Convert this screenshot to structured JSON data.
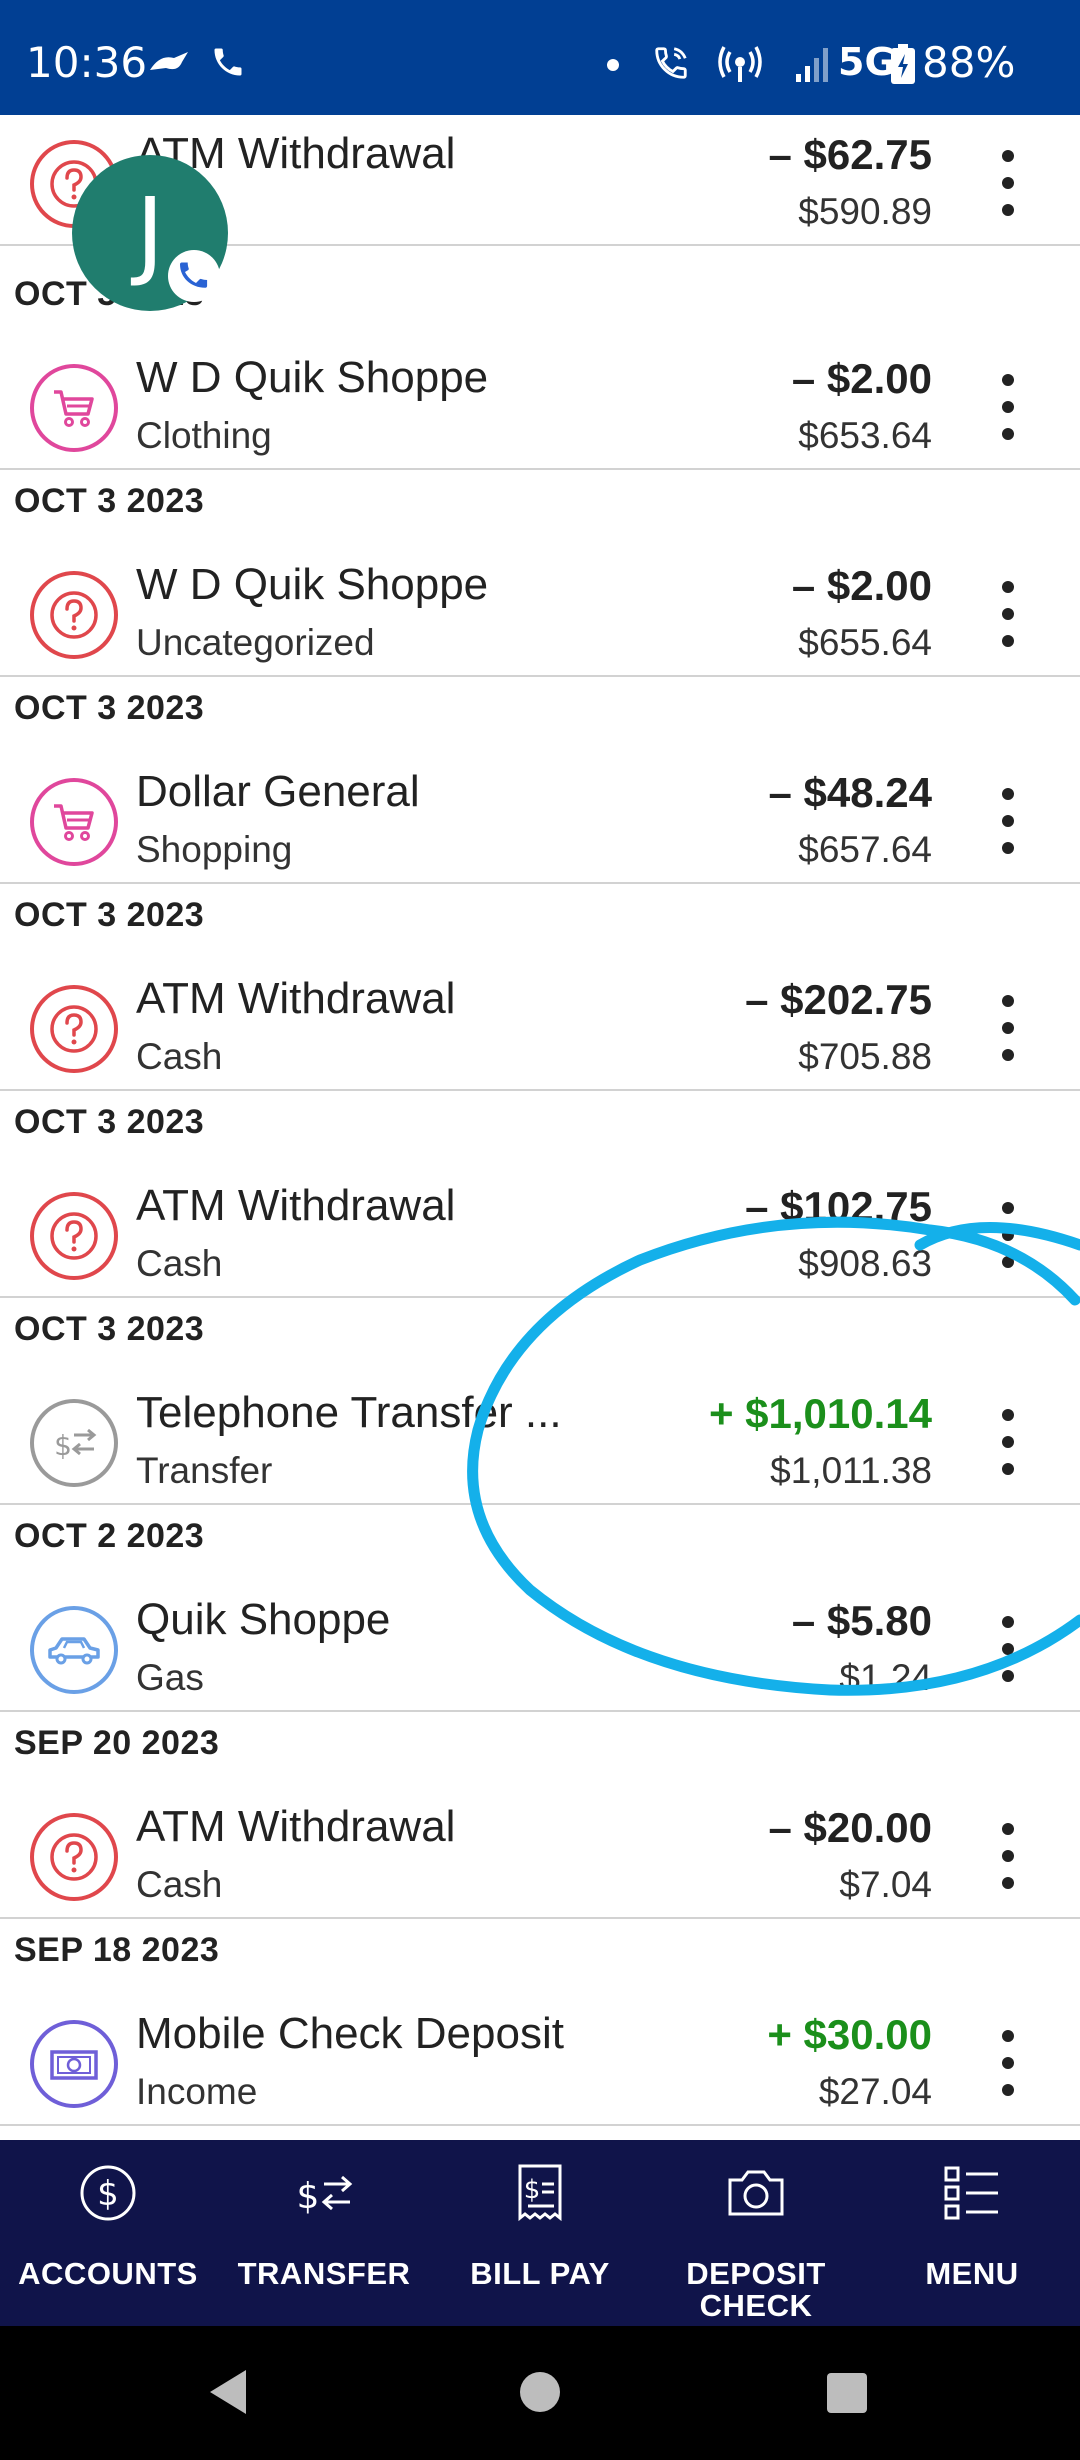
{
  "status_bar": {
    "time": "10:36",
    "network": "5G",
    "battery": "88%"
  },
  "avatar": {
    "initial": "J"
  },
  "transactions": [
    {
      "date": "",
      "name": "ATM Withdrawal",
      "category": "",
      "amount": "– $62.75",
      "balance": "$590.89",
      "type": "debit",
      "icon": "question-icon",
      "icon_color": "#e0474c"
    },
    {
      "date": "OCT 3 2023",
      "name": "W D Quik Shoppe",
      "category": "Clothing",
      "amount": "– $2.00",
      "balance": "$653.64",
      "type": "debit",
      "icon": "cart-icon",
      "icon_color": "#e0479c"
    },
    {
      "date": "OCT 3 2023",
      "name": "W D Quik Shoppe",
      "category": "Uncategorized",
      "amount": "– $2.00",
      "balance": "$655.64",
      "type": "debit",
      "icon": "question-icon",
      "icon_color": "#e0474c"
    },
    {
      "date": "OCT 3 2023",
      "name": "Dollar General",
      "category": "Shopping",
      "amount": "– $48.24",
      "balance": "$657.64",
      "type": "debit",
      "icon": "cart-icon",
      "icon_color": "#e0479c"
    },
    {
      "date": "OCT 3 2023",
      "name": "ATM Withdrawal",
      "category": "Cash",
      "amount": "– $202.75",
      "balance": "$705.88",
      "type": "debit",
      "icon": "question-icon",
      "icon_color": "#e0474c"
    },
    {
      "date": "OCT 3 2023",
      "name": "ATM Withdrawal",
      "category": "Cash",
      "amount": "– $102.75",
      "balance": "$908.63",
      "type": "debit",
      "icon": "question-icon",
      "icon_color": "#e0474c"
    },
    {
      "date": "OCT 3 2023",
      "name": "Telephone Transfer ...",
      "category": "Transfer",
      "amount": "+ $1,010.14",
      "balance": "$1,011.38",
      "type": "credit",
      "icon": "transfer-icon",
      "icon_color": "#9a9a9a"
    },
    {
      "date": "OCT 2 2023",
      "name": "Quik Shoppe",
      "category": "Gas",
      "amount": "– $5.80",
      "balance": "$1.24",
      "type": "debit",
      "icon": "car-icon",
      "icon_color": "#6aa0e6"
    },
    {
      "date": "SEP 20 2023",
      "name": "ATM Withdrawal",
      "category": "Cash",
      "amount": "– $20.00",
      "balance": "$7.04",
      "type": "debit",
      "icon": "question-icon",
      "icon_color": "#e0474c"
    },
    {
      "date": "SEP 18 2023",
      "name": "Mobile Check Deposit",
      "category": "Income",
      "amount": "+ $30.00",
      "balance": "$27.04",
      "type": "credit",
      "icon": "money-icon",
      "icon_color": "#6f5fd8"
    }
  ],
  "bottom_nav": [
    {
      "label": "ACCOUNTS",
      "icon": "dollar-circle-icon"
    },
    {
      "label": "TRANSFER",
      "icon": "transfer-arrows-icon"
    },
    {
      "label": "BILL PAY",
      "icon": "receipt-icon"
    },
    {
      "label": "DEPOSIT\nCHECK",
      "icon": "camera-icon"
    },
    {
      "label": "MENU",
      "icon": "menu-list-icon"
    }
  ],
  "colors": {
    "status_bar_bg": "#013f93",
    "bottom_nav_bg": "#10144a",
    "credit": "#1b8f1b",
    "annotation": "#14b0ea"
  }
}
